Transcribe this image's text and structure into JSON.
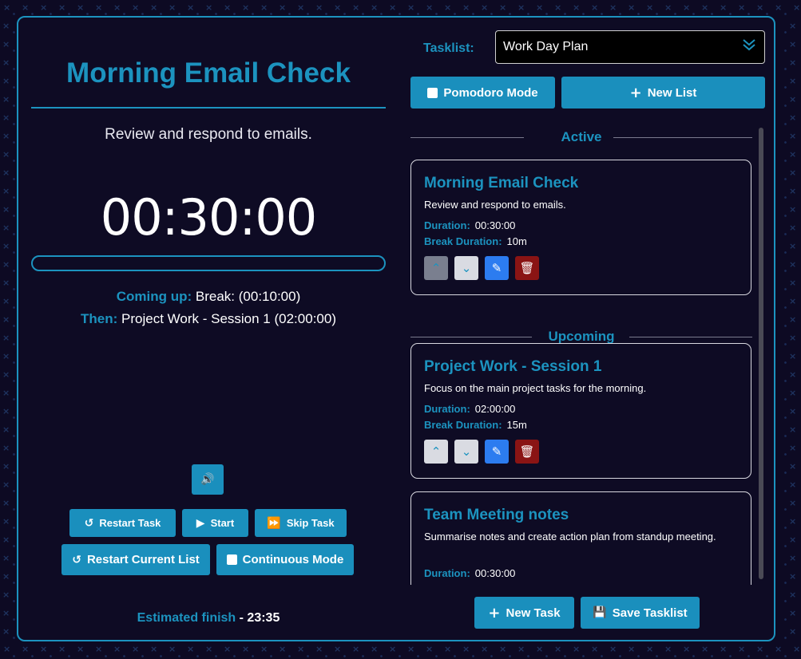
{
  "timer_panel": {
    "title": "Morning Email Check",
    "description": "Review and respond to emails.",
    "time": "00:30:00",
    "progress": 0,
    "coming_up_label": "Coming up:",
    "coming_up_value": "Break: (00:10:00)",
    "then_label": "Then:",
    "then_value": "Project Work - Session 1 (02:00:00)",
    "buttons": {
      "restart_task": "Restart Task",
      "start": "Start",
      "skip_task": "Skip Task",
      "restart_list": "Restart Current List",
      "continuous": "Continuous Mode"
    },
    "estimated_label": "Estimated finish",
    "estimated_value": "- 23:35"
  },
  "tasklist": {
    "label": "Tasklist:",
    "selected": "Work Day Plan",
    "pomodoro_label": "Pomodoro Mode",
    "new_list_label": "New List"
  },
  "sections": {
    "active": "Active",
    "upcoming": "Upcoming"
  },
  "tasks": [
    {
      "title": "Morning Email Check",
      "description": "Review and respond to emails.",
      "duration_label": "Duration:",
      "duration": "00:30:00",
      "break_label": "Break Duration:",
      "break": "10m"
    },
    {
      "title": "Project Work - Session 1",
      "description": "Focus on the main project tasks for the morning.",
      "duration_label": "Duration:",
      "duration": "02:00:00",
      "break_label": "Break Duration:",
      "break": "15m"
    },
    {
      "title": "Team Meeting notes",
      "description": "Summarise notes and create action plan from standup meeting.",
      "duration_label": "Duration:",
      "duration": "00:30:00"
    }
  ],
  "footer": {
    "new_task_label": "New Task",
    "save_tasklist_label": "Save Tasklist"
  },
  "colors": {
    "accent": "#1c93bf",
    "background": "#0d0a23",
    "delete": "#8a1414",
    "edit": "#2c7cf0"
  }
}
